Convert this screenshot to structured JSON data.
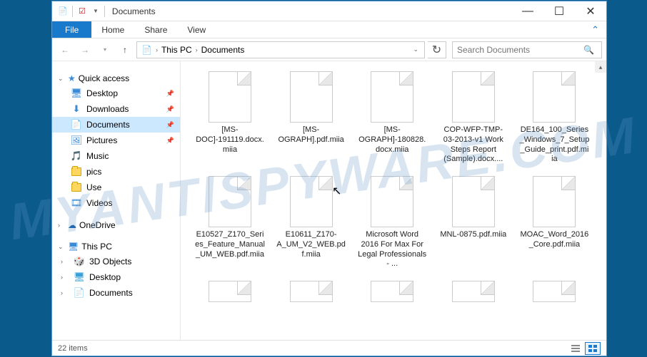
{
  "window": {
    "title": "Documents",
    "minimize": "—",
    "maximize": "☐",
    "close": "✕"
  },
  "ribbon": {
    "file": "File",
    "tabs": [
      "Home",
      "Share",
      "View"
    ]
  },
  "address": {
    "segments": [
      "This PC",
      "Documents"
    ],
    "refresh": "↻"
  },
  "search": {
    "placeholder": "Search Documents",
    "icon": "🔍"
  },
  "nav": {
    "quick_access": {
      "label": "Quick access",
      "items": [
        {
          "icon": "🖥",
          "label": "Desktop",
          "pinned": true,
          "color": "#3a8ad6"
        },
        {
          "icon": "⬇",
          "label": "Downloads",
          "pinned": true,
          "color": "#3a8ad6"
        },
        {
          "icon": "📄",
          "label": "Documents",
          "pinned": true,
          "selected": true,
          "color": "#3a8ad6"
        },
        {
          "icon": "🖼",
          "label": "Pictures",
          "pinned": true,
          "color": "#3a8ad6"
        },
        {
          "icon": "🎵",
          "label": "Music",
          "pinned": false,
          "color": "#3a8ad6"
        },
        {
          "icon": "📁",
          "label": "pics",
          "pinned": false,
          "folder": true
        },
        {
          "icon": "📁",
          "label": "Use",
          "pinned": false,
          "folder": true
        },
        {
          "icon": "🎞",
          "label": "Videos",
          "pinned": false,
          "color": "#3a8ad6"
        }
      ]
    },
    "onedrive": {
      "icon": "☁",
      "label": "OneDrive"
    },
    "this_pc": {
      "label": "This PC",
      "items": [
        {
          "icon": "🎲",
          "label": "3D Objects"
        },
        {
          "icon": "🖥",
          "label": "Desktop"
        },
        {
          "icon": "📄",
          "label": "Documents"
        }
      ]
    }
  },
  "files": [
    {
      "name": "[MS-DOC]-191119.docx.miia"
    },
    {
      "name": "[MS-OGRAPH].pdf.miia"
    },
    {
      "name": "[MS-OGRAPH]-180828.docx.miia"
    },
    {
      "name": "COP-WFP-TMP-03-2013-v1 Work Steps Report (Sample).docx...."
    },
    {
      "name": "DE164_100_Series_Windows_7_Setup_Guide_print.pdf.miia"
    },
    {
      "name": "E10527_Z170_Series_Feature_Manual_UM_WEB.pdf.miia"
    },
    {
      "name": "E10611_Z170-A_UM_V2_WEB.pdf.miia"
    },
    {
      "name": "Microsoft Word 2016 For Max For Legal Professionals - ..."
    },
    {
      "name": "MNL-0875.pdf.miia"
    },
    {
      "name": "MOAC_Word_2016_Core.pdf.miia"
    }
  ],
  "status": {
    "items": "22 items"
  }
}
